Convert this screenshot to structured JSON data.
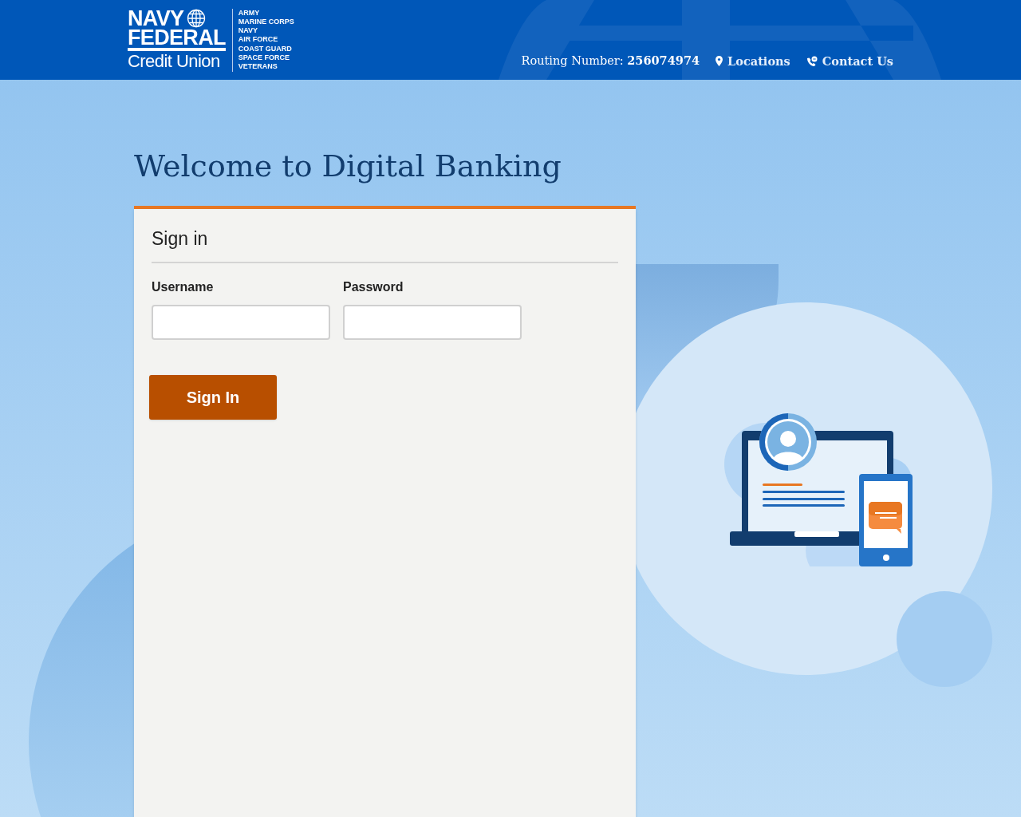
{
  "header": {
    "logo": {
      "line_1": "NAVY",
      "line_2": "FEDERAL",
      "line_3": "Credit Union",
      "branches": [
        "ARMY",
        "MARINE CORPS",
        "NAVY",
        "AIR FORCE",
        "COAST GUARD",
        "SPACE FORCE",
        "VETERANS"
      ]
    },
    "routing": {
      "label": "Routing Number:",
      "number": "256074974"
    },
    "links": [
      {
        "kind": "location",
        "label": "Locations"
      },
      {
        "kind": "contact",
        "label": "Contact Us"
      }
    ]
  },
  "title": "Welcome to Digital Banking",
  "signin": {
    "heading": "Sign in",
    "fields": [
      {
        "label": "Username"
      },
      {
        "label": "Password"
      }
    ],
    "button": "Sign In"
  }
}
